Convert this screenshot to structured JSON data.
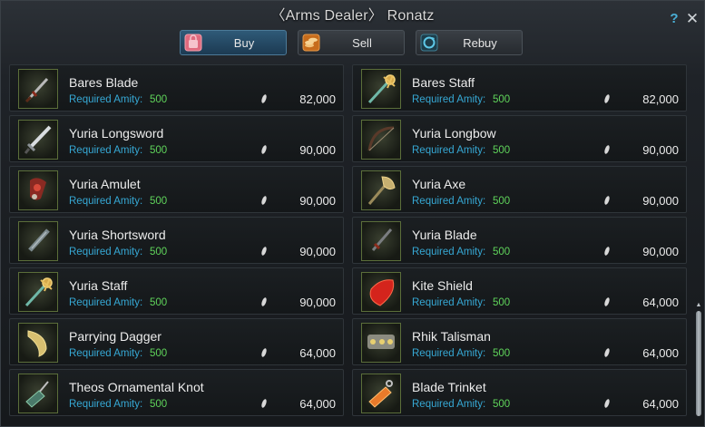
{
  "window": {
    "title": "〈Arms Dealer〉 Ronatz",
    "help_label": "?",
    "close_label": "✕"
  },
  "tabs": [
    {
      "label": "Buy",
      "icon": "bag-icon",
      "active": true
    },
    {
      "label": "Sell",
      "icon": "coins-icon",
      "active": false
    },
    {
      "label": "Rebuy",
      "icon": "cycle-icon",
      "active": false
    }
  ],
  "amity_label": "Required Amity:",
  "items": [
    {
      "name": "Bares Blade",
      "amity": "500",
      "price": "82,000",
      "icon": "dagger-icon"
    },
    {
      "name": "Bares Staff",
      "amity": "500",
      "price": "82,000",
      "icon": "staff-icon"
    },
    {
      "name": "Yuria Longsword",
      "amity": "500",
      "price": "90,000",
      "icon": "longsword-icon"
    },
    {
      "name": "Yuria Longbow",
      "amity": "500",
      "price": "90,000",
      "icon": "bow-icon"
    },
    {
      "name": "Yuria Amulet",
      "amity": "500",
      "price": "90,000",
      "icon": "amulet-icon"
    },
    {
      "name": "Yuria Axe",
      "amity": "500",
      "price": "90,000",
      "icon": "axe-icon"
    },
    {
      "name": "Yuria Shortsword",
      "amity": "500",
      "price": "90,000",
      "icon": "shortsword-icon"
    },
    {
      "name": "Yuria Blade",
      "amity": "500",
      "price": "90,000",
      "icon": "blade-icon"
    },
    {
      "name": "Yuria Staff",
      "amity": "500",
      "price": "90,000",
      "icon": "staff-icon"
    },
    {
      "name": "Kite Shield",
      "amity": "500",
      "price": "64,000",
      "icon": "shield-icon"
    },
    {
      "name": "Parrying Dagger",
      "amity": "500",
      "price": "64,000",
      "icon": "curved-dagger-icon"
    },
    {
      "name": "Rhik Talisman",
      "amity": "500",
      "price": "64,000",
      "icon": "talisman-icon"
    },
    {
      "name": "Theos Ornamental Knot",
      "amity": "500",
      "price": "64,000",
      "icon": "knot-icon"
    },
    {
      "name": "Blade Trinket",
      "amity": "500",
      "price": "64,000",
      "icon": "trinket-icon"
    }
  ],
  "colors": {
    "amity_label": "#36a8d4",
    "amity_value": "#5fd35a",
    "active_tab": "#2f5a78",
    "slot_border": "#5b6e3a"
  }
}
